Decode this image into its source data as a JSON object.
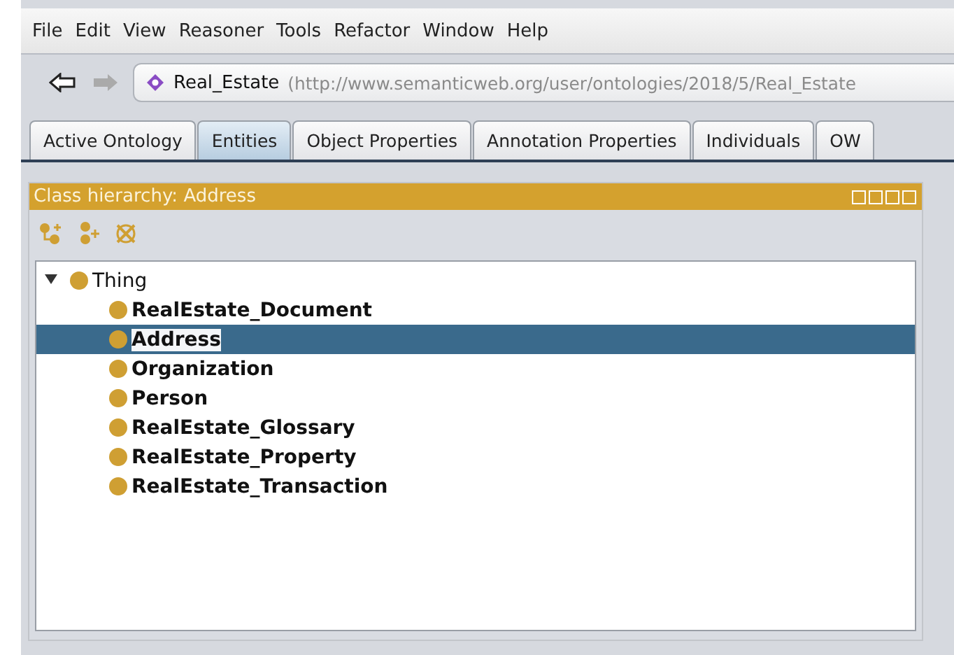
{
  "menu": [
    "File",
    "Edit",
    "View",
    "Reasoner",
    "Tools",
    "Refactor",
    "Window",
    "Help"
  ],
  "address_bar": {
    "name": "Real_Estate",
    "iri": "(http://www.semanticweb.org/user/ontologies/2018/5/Real_Estate"
  },
  "tabs": [
    {
      "label": "Active Ontology",
      "selected": false
    },
    {
      "label": "Entities",
      "selected": true
    },
    {
      "label": "Object Properties",
      "selected": false
    },
    {
      "label": "Annotation Properties",
      "selected": false
    },
    {
      "label": "Individuals",
      "selected": false
    },
    {
      "label": "OW",
      "selected": false
    }
  ],
  "panel": {
    "title": "Class hierarchy: Address",
    "tree": [
      {
        "label": "Thing",
        "expanded": true,
        "selected": false,
        "children": [
          {
            "label": "RealEstate_Document",
            "selected": false
          },
          {
            "label": "Address",
            "selected": true
          },
          {
            "label": "Organization",
            "selected": false
          },
          {
            "label": "Person",
            "selected": false
          },
          {
            "label": "RealEstate_Glossary",
            "selected": false
          },
          {
            "label": "RealEstate_Property",
            "selected": false
          },
          {
            "label": "RealEstate_Transaction",
            "selected": false
          }
        ]
      }
    ]
  }
}
